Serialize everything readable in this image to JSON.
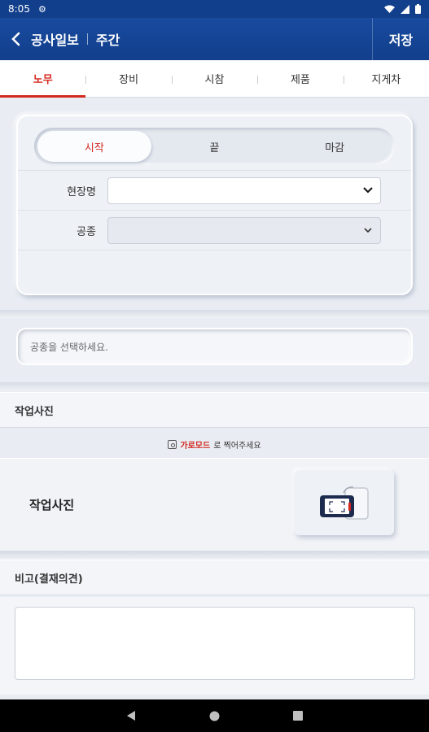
{
  "status_bar": {
    "time": "8:05",
    "settings_glyph": "⚙"
  },
  "header": {
    "title": "공사일보",
    "subtitle": "주간",
    "save_label": "저장"
  },
  "tabs": [
    {
      "label": "노무",
      "active": true
    },
    {
      "label": "장비",
      "active": false
    },
    {
      "label": "시참",
      "active": false
    },
    {
      "label": "제품",
      "active": false
    },
    {
      "label": "지게차",
      "active": false
    }
  ],
  "segment": {
    "options": [
      {
        "label": "시작",
        "active": true
      },
      {
        "label": "끝",
        "active": false
      },
      {
        "label": "마감",
        "active": false
      }
    ]
  },
  "form": {
    "site_label": "현장명",
    "site_value": "",
    "trade_label": "공종",
    "trade_value": ""
  },
  "notice_text": "공종을 선택하세요.",
  "work_photo_section": {
    "header": "작업사진",
    "hint_prefix": "가로모드",
    "hint_suffix": "로 찍어주세요",
    "card_label": "작업사진"
  },
  "remarks": {
    "header": "비고(결재의견)",
    "value": ""
  },
  "colors": {
    "brand_blue": "#123f8c",
    "accent_red": "#d3281f"
  }
}
